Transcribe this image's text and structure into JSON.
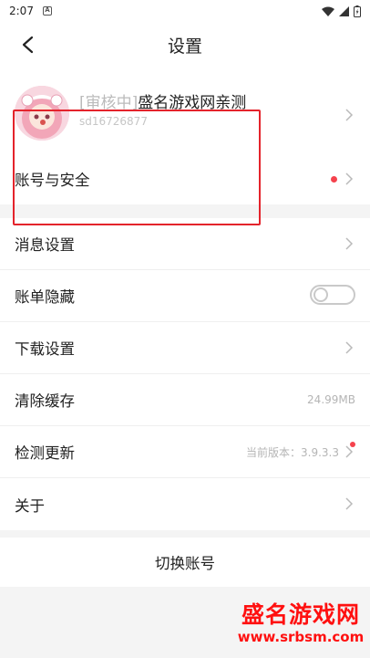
{
  "status_bar": {
    "time": "2:07",
    "a_icon": "A"
  },
  "navbar": {
    "title": "设置",
    "back_icon": "chevron-left-icon"
  },
  "profile": {
    "tag": "[审核中]",
    "name": "盛名游戏网亲测",
    "uid": "sd16726877"
  },
  "rows": {
    "account_security": {
      "label": "账号与安全",
      "has_red_dot": true
    },
    "message_settings": {
      "label": "消息设置"
    },
    "hide_bill": {
      "label": "账单隐藏",
      "enabled": false
    },
    "download_settings": {
      "label": "下载设置"
    },
    "clear_cache": {
      "label": "清除缓存",
      "value": "24.99MB"
    },
    "check_update": {
      "label": "检测更新",
      "value": "当前版本：3.9.3.3",
      "has_red_dot": true
    },
    "about": {
      "label": "关于"
    }
  },
  "switch_account": {
    "label": "切换账号"
  },
  "watermark": {
    "title": "盛名游戏网",
    "url": "www.srbsm.com"
  },
  "colors": {
    "accent_red": "#e4232b",
    "dot_red": "#f5424d",
    "separator": "#f4f4f4"
  }
}
